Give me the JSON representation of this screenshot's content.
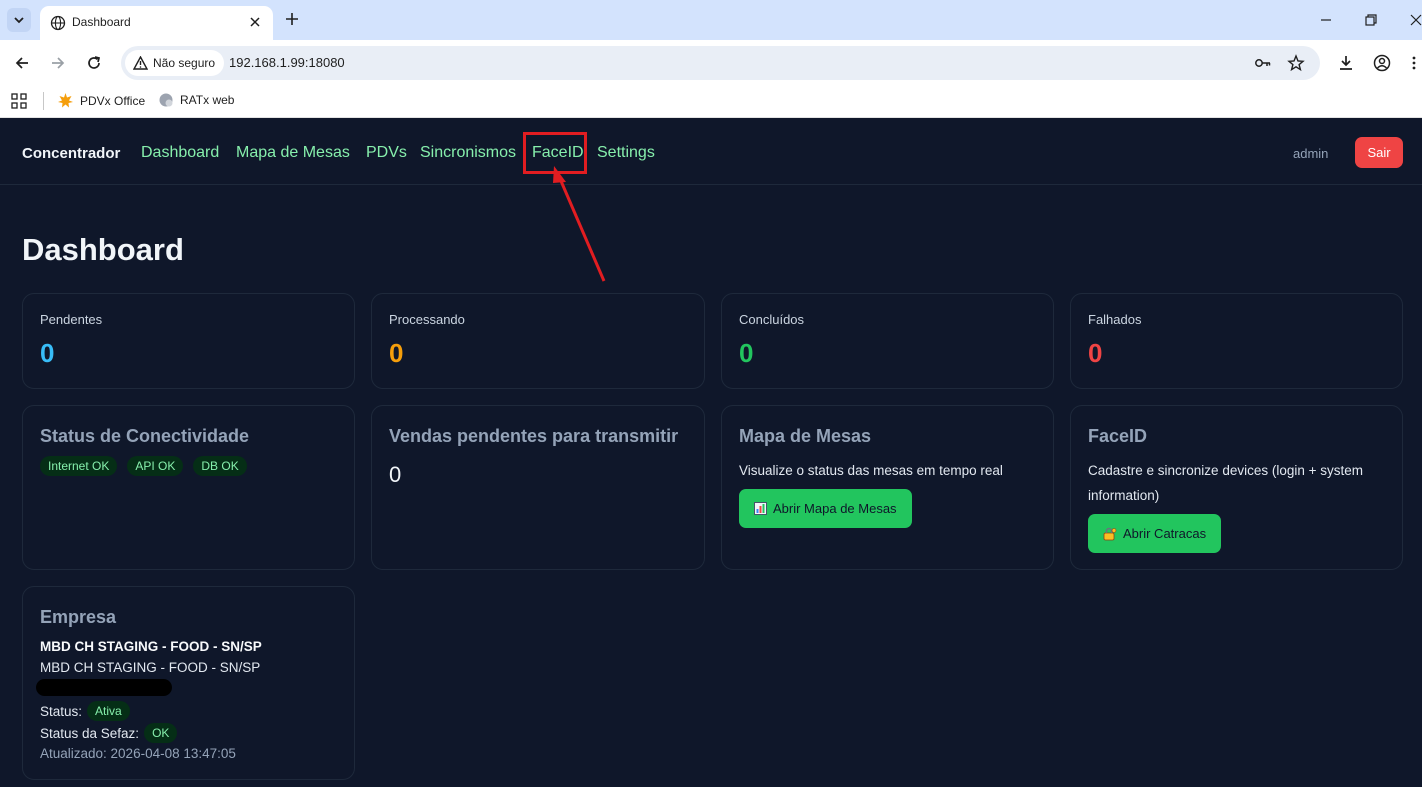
{
  "browser": {
    "tab_title": "Dashboard",
    "security_label": "Não seguro",
    "url": "192.168.1.99:18080",
    "bookmarks": [
      {
        "label": "PDVx Office",
        "icon": "pdvx-logo-icon"
      },
      {
        "label": "RATx web",
        "icon": "ratx-logo-icon"
      }
    ]
  },
  "nav": {
    "brand": "Concentrador",
    "links": [
      "Dashboard",
      "Mapa de Mesas",
      "PDVs",
      "Sincronismos",
      "FaceID",
      "Settings"
    ],
    "user": "admin",
    "logout_label": "Sair",
    "highlighted_link": "FaceID"
  },
  "page": {
    "title": "Dashboard"
  },
  "stats": [
    {
      "label": "Pendentes",
      "value": "0",
      "color": "#38bdf8"
    },
    {
      "label": "Processando",
      "value": "0",
      "color": "#f59e0b"
    },
    {
      "label": "Concluídos",
      "value": "0",
      "color": "#22c55e"
    },
    {
      "label": "Falhados",
      "value": "0",
      "color": "#ef4444"
    }
  ],
  "connectivity": {
    "title": "Status de Conectividade",
    "badges": [
      "Internet OK",
      "API OK",
      "DB OK"
    ]
  },
  "pending_sales": {
    "title": "Vendas pendentes para transmitir",
    "value": "0"
  },
  "table_map": {
    "title": "Mapa de Mesas",
    "description": "Visualize o status das mesas em tempo real",
    "button_label": "Abrir Mapa de Mesas",
    "button_icon": "bar-chart-icon"
  },
  "faceid": {
    "title": "FaceID",
    "description_line1": "Cadastre e sincronize devices (login + system",
    "description_line2": "information)",
    "button_label": "Abrir Catracas",
    "button_icon": "lock-key-icon"
  },
  "empresa": {
    "title": "Empresa",
    "name_bold": "MBD CH STAGING - FOOD - SN/SP",
    "name": "MBD CH STAGING - FOOD - SN/SP",
    "status_label": "Status:",
    "status_value": "Ativa",
    "sefaz_label": "Status da Sefaz:",
    "sefaz_value": "OK",
    "updated": "Atualizado: 2026-04-08 13:47:05"
  }
}
